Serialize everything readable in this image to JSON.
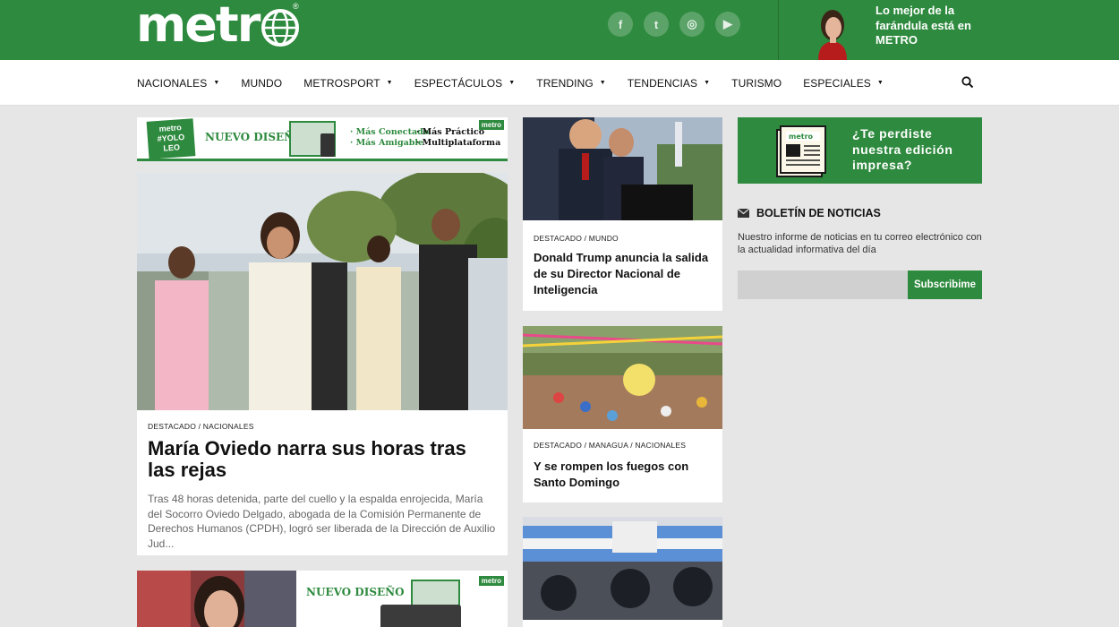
{
  "header": {
    "logo_text": "metro",
    "trademark": "®",
    "social": [
      {
        "name": "facebook-icon",
        "glyph": "f"
      },
      {
        "name": "twitter-icon",
        "glyph": "t"
      },
      {
        "name": "instagram-icon",
        "glyph": "◎"
      },
      {
        "name": "youtube-icon",
        "glyph": "▶"
      }
    ],
    "promo_text": "Lo mejor de la farándula está en METRO"
  },
  "nav": {
    "items": [
      {
        "label": "NACIONALES",
        "dropdown": "▼"
      },
      {
        "label": "MUNDO"
      },
      {
        "label": "METROSPORT",
        "dropdown": "▼"
      },
      {
        "label": "ESPECTÁCULOS",
        "dropdown": "▼"
      },
      {
        "label": "TRENDING",
        "dropdown": "▼"
      },
      {
        "label": "TENDENCIAS",
        "dropdown": "▼"
      },
      {
        "label": "TURISMO"
      },
      {
        "label": "ESPECIALES",
        "dropdown": "▼"
      }
    ]
  },
  "banner_top": {
    "badge_line1": "metro",
    "badge_line2": "#YOLO",
    "badge_line3": "LEO",
    "title": "NUEVO DISEÑO",
    "feature1": "· Más Conectado",
    "feature2": "· Más Amigable",
    "feature3": "· Más Práctico",
    "feature4": "· Multiplataforma",
    "metro_tag": "metro"
  },
  "main_story": {
    "category_1": "DESTACADO",
    "category_sep": " / ",
    "category_2": "NACIONALES",
    "title": "María Oviedo narra sus horas tras las rejas",
    "excerpt": "Tras 48 horas detenida, parte del cuello y la espalda enrojecida, María del Socorro Oviedo Delgado, abogada de la Comisión Permanente de Derechos Humanos (CPDH), logró ser liberada de la Dirección de Auxilio Jud..."
  },
  "banner_bottom": {
    "title": "NUEVO DISEÑO",
    "metro_tag": "metro"
  },
  "side_stories": [
    {
      "category": "DESTACADO / MUNDO",
      "title": "Donald Trump anuncia la salida de su Director Nacional de Inteligencia"
    },
    {
      "category": "DESTACADO / MANAGUA / NACIONALES",
      "title": "Y se rompen los fuegos con Santo Domingo"
    }
  ],
  "edition": {
    "text": "¿Te perdiste nuestra edición impresa?",
    "icon_label": "metro"
  },
  "newsletter": {
    "title": "BOLETÍN DE NOTICIAS",
    "description": "Nuestro informe de noticias en tu correo electrónico con la actualidad informativa del día",
    "input_placeholder": "",
    "button_label": "Subscribime"
  },
  "colors": {
    "brand_green": "#2e8a3e",
    "page_bg": "#e6e6e6"
  }
}
